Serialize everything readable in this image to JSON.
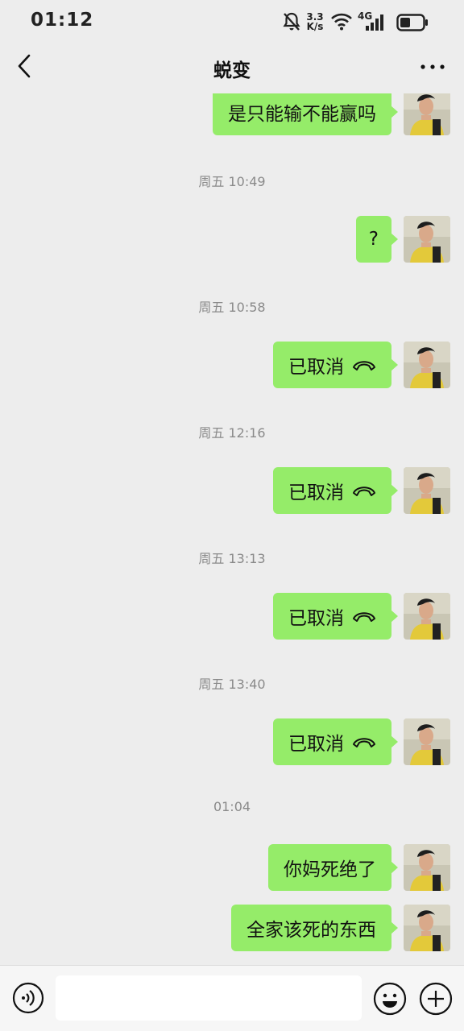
{
  "status_bar": {
    "time": "01:12",
    "net_speed_value": "3.3",
    "net_speed_unit": "K/s",
    "network_type": "4G"
  },
  "header": {
    "title": "蜕变"
  },
  "chat": {
    "messages": [
      {
        "text": "是只能输不能赢吗",
        "call": false
      },
      {
        "timestamp": "周五 10:49"
      },
      {
        "text": "?",
        "call": false
      },
      {
        "timestamp": "周五 10:58"
      },
      {
        "text": "已取消",
        "call": true
      },
      {
        "timestamp": "周五 12:16"
      },
      {
        "text": "已取消",
        "call": true
      },
      {
        "timestamp": "周五 13:13"
      },
      {
        "text": "已取消",
        "call": true
      },
      {
        "timestamp": "周五 13:40"
      },
      {
        "text": "已取消",
        "call": true
      },
      {
        "timestamp": "01:04"
      },
      {
        "text": "你妈死绝了",
        "call": false
      },
      {
        "text": "全家该死的东西",
        "call": false
      }
    ]
  },
  "input": {
    "value": "",
    "placeholder": ""
  },
  "colors": {
    "bubble": "#95ec69",
    "background": "#ededed"
  }
}
